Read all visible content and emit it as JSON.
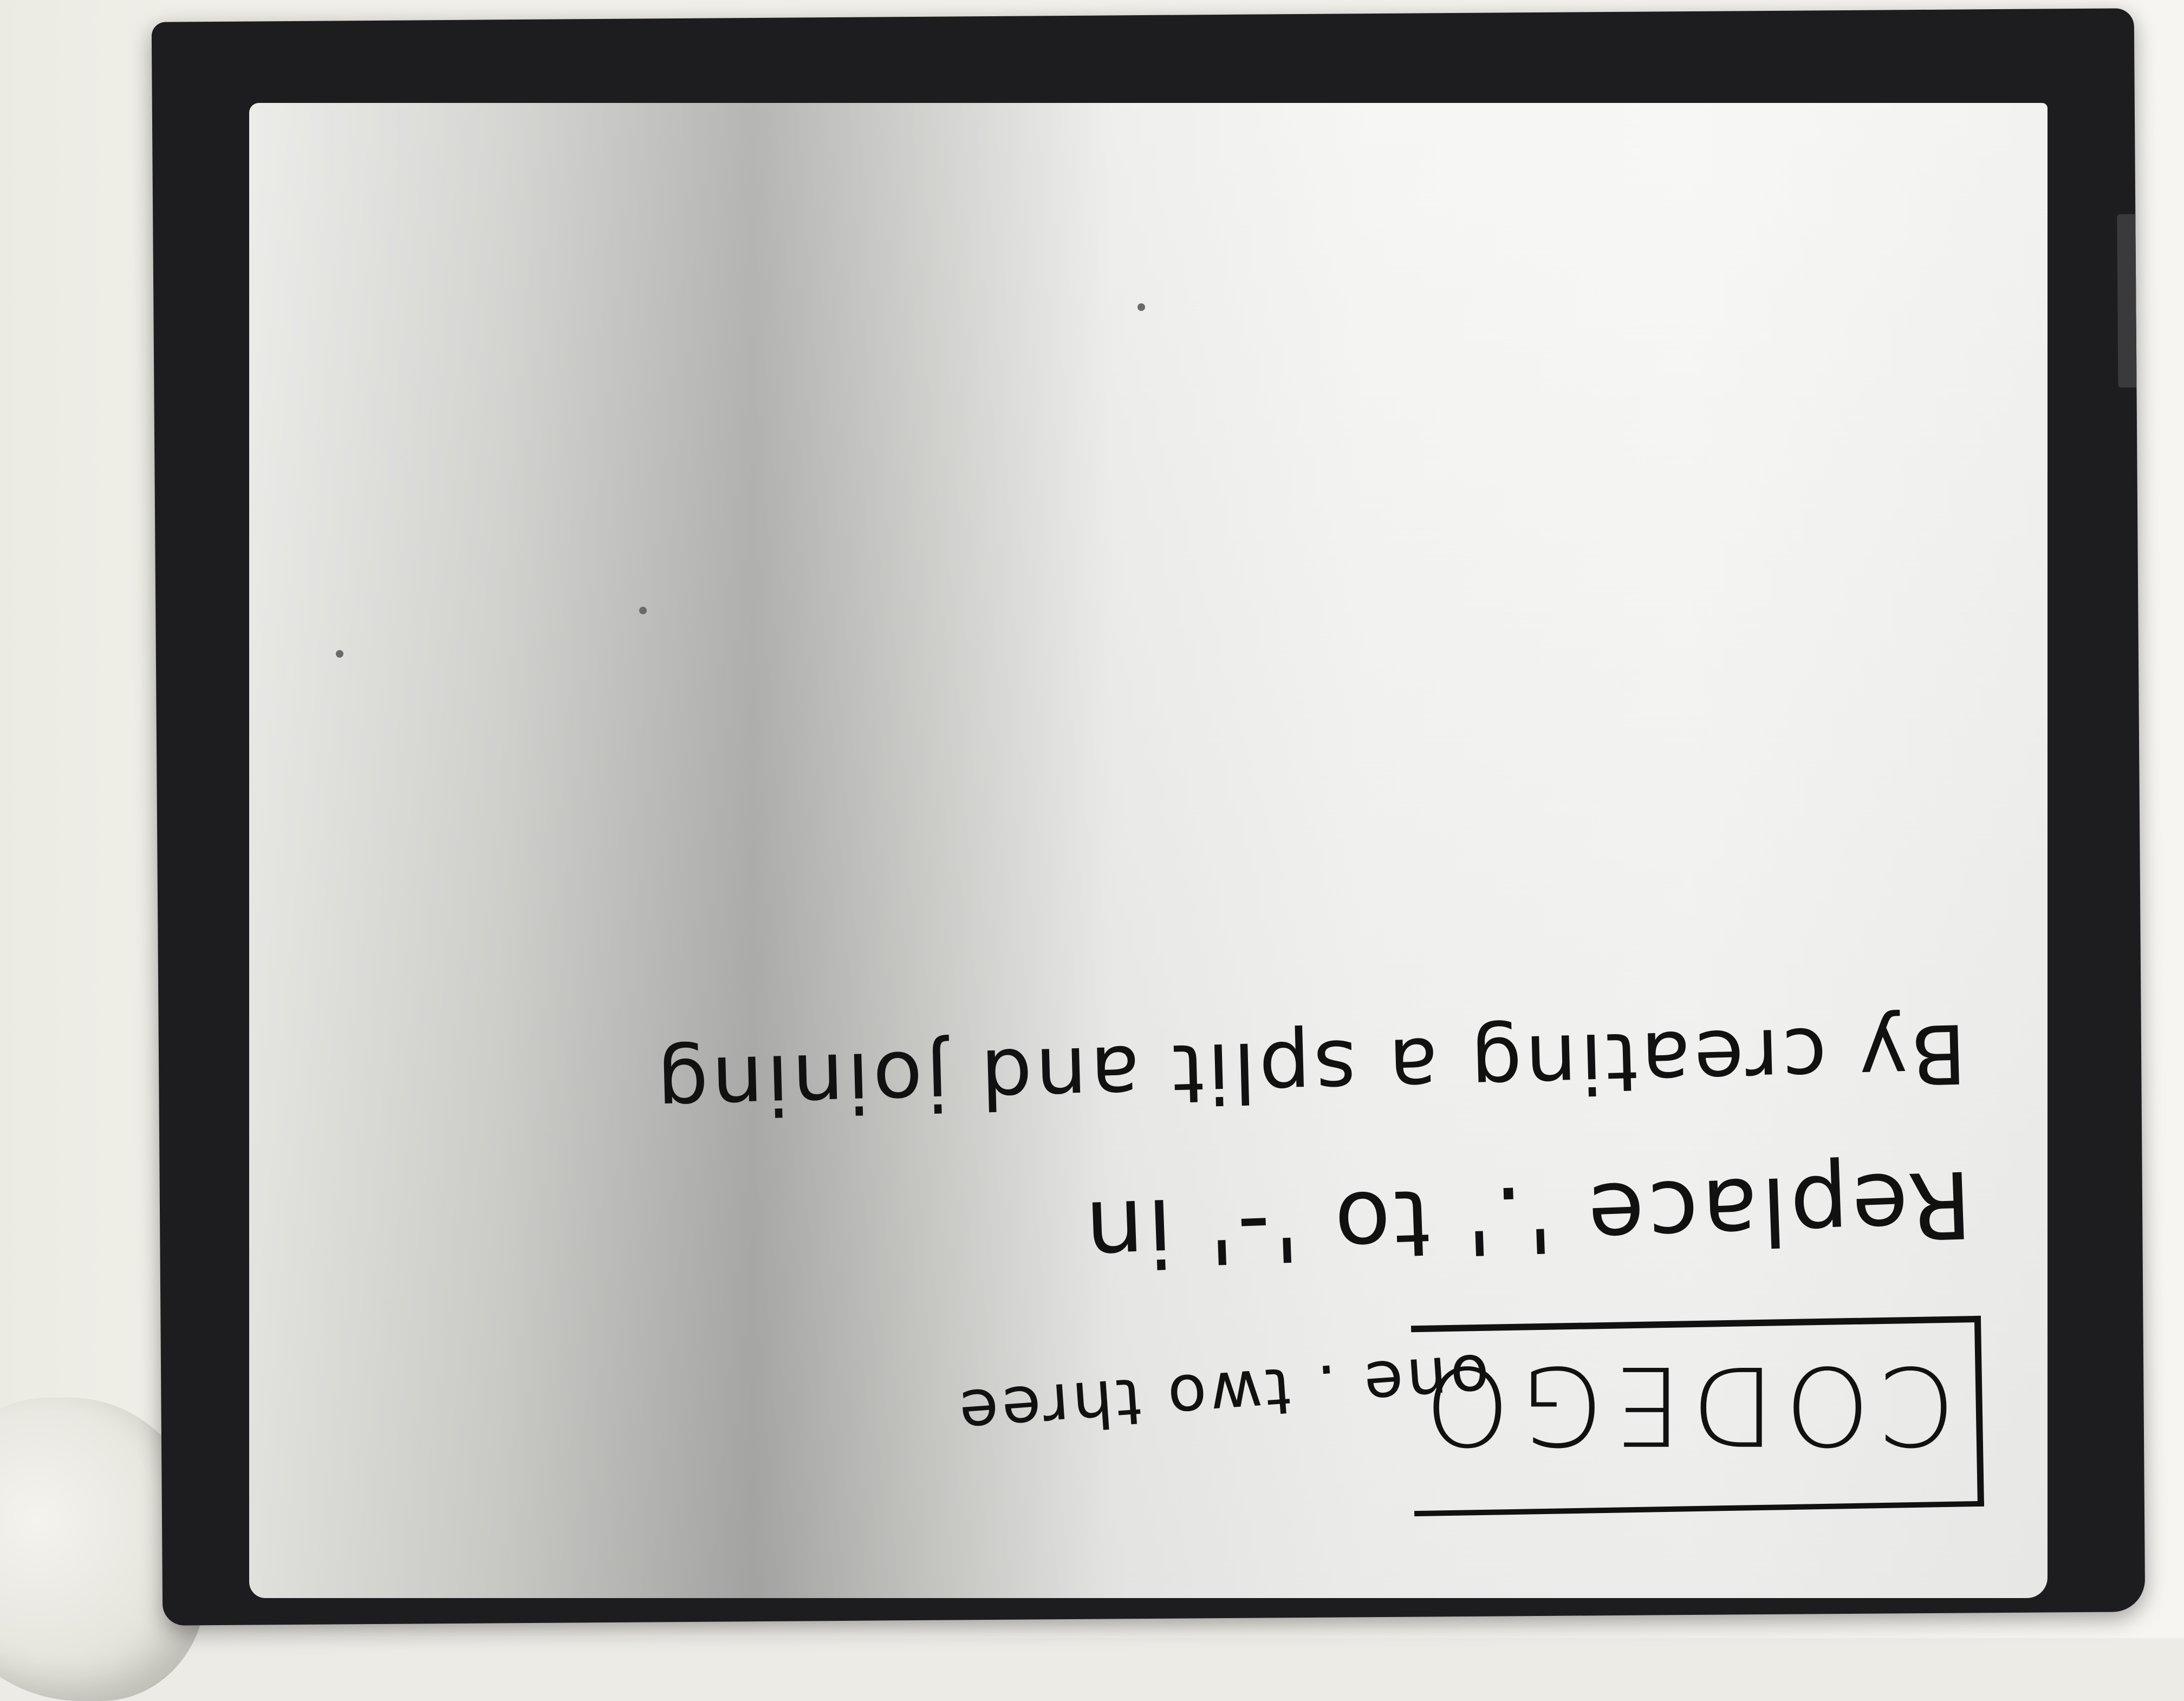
{
  "whiteboard": {
    "title": "CODEGO",
    "lines": [
      "one . two three",
      "Replace '.' to '-' in",
      "By creating a split and joining"
    ]
  }
}
